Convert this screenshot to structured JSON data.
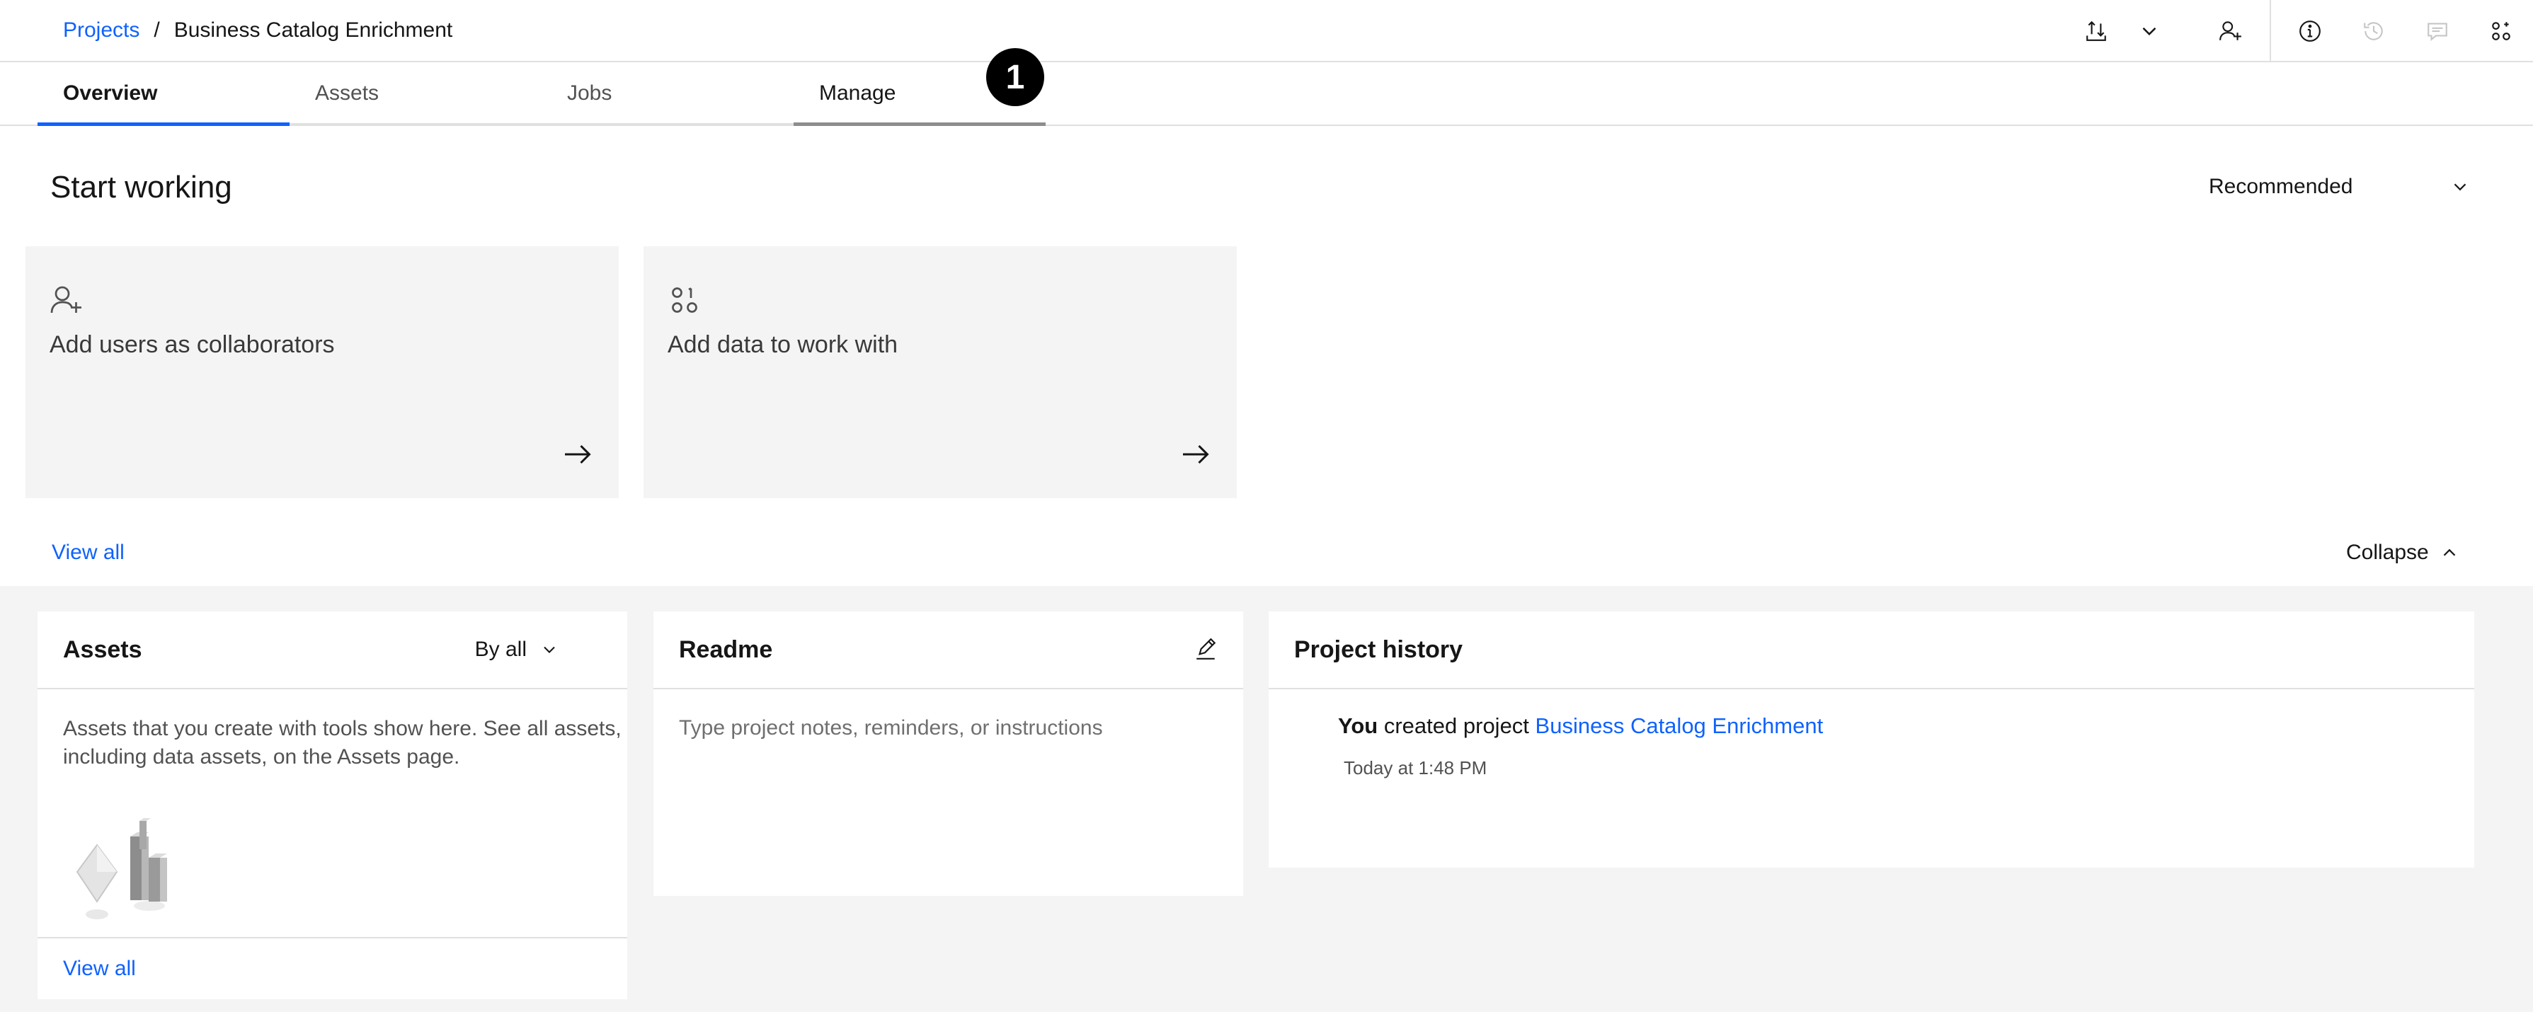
{
  "breadcrumb": {
    "root": "Projects",
    "separator": "/",
    "current": "Business Catalog Enrichment"
  },
  "toolbar": {
    "icons": [
      "import-export-icon",
      "chevron-down-icon",
      "add-user-icon",
      "info-icon",
      "history-icon",
      "comment-icon",
      "apps-icon"
    ]
  },
  "tabs": [
    {
      "label": "Overview"
    },
    {
      "label": "Assets"
    },
    {
      "label": "Jobs"
    },
    {
      "label": "Manage"
    }
  ],
  "annotation_badge": "1",
  "start": {
    "title": "Start working",
    "dropdown_value": "Recommended",
    "tiles": [
      {
        "label": "Add users as collaborators",
        "icon": "add-user-icon"
      },
      {
        "label": "Add data to work with",
        "icon": "data-icon"
      }
    ],
    "view_all": "View all",
    "collapse": "Collapse"
  },
  "assets_card": {
    "title": "Assets",
    "filter": "By all",
    "description": "Assets that you create with tools show here. See all assets, including data assets, on the Assets page.",
    "view_all": "View all"
  },
  "readme_card": {
    "title": "Readme",
    "placeholder": "Type project notes, reminders, or instructions"
  },
  "history_card": {
    "title": "Project history",
    "actor": "You",
    "action": " created project ",
    "project": "Business Catalog Enrichment",
    "time": "Today at 1:48 PM"
  },
  "colors": {
    "link": "#0f62fe",
    "tile_bg": "#f4f4f4",
    "border": "#e0e0e0"
  }
}
